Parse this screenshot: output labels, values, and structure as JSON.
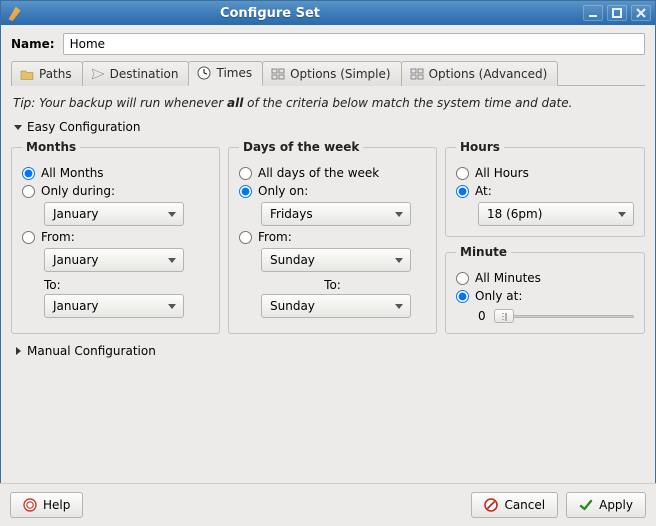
{
  "window": {
    "title": "Configure Set"
  },
  "name": {
    "label": "Name:",
    "value": "Home"
  },
  "tabs": [
    {
      "label": "Paths",
      "active": false
    },
    {
      "label": "Destination",
      "active": false
    },
    {
      "label": "Times",
      "active": true
    },
    {
      "label": "Options (Simple)",
      "active": false
    },
    {
      "label": "Options (Advanced)",
      "active": false
    }
  ],
  "tip": {
    "prefix": "Tip: Your backup will run whenever ",
    "bold": "all",
    "suffix": " of the criteria below match the system time and date."
  },
  "easy_expander": "Easy Configuration",
  "months": {
    "legend": "Months",
    "all": "All Months",
    "only_during": "Only during:",
    "only_value": "January",
    "from_label": "From:",
    "from_value": "January",
    "to_label": "To:",
    "to_value": "January"
  },
  "days": {
    "legend": "Days of the week",
    "all": "All days of the week",
    "only_on": "Only on:",
    "only_value": "Fridays",
    "from_label": "From:",
    "from_value": "Sunday",
    "to_label": "To:",
    "to_value": "Sunday"
  },
  "hours": {
    "legend": "Hours",
    "all": "All Hours",
    "at_label": "At:",
    "at_value": "18 (6pm)"
  },
  "minute": {
    "legend": "Minute",
    "all": "All Minutes",
    "only_at": "Only at:",
    "value": "0"
  },
  "manual_expander": "Manual Configuration",
  "buttons": {
    "help": "Help",
    "cancel": "Cancel",
    "apply": "Apply"
  }
}
